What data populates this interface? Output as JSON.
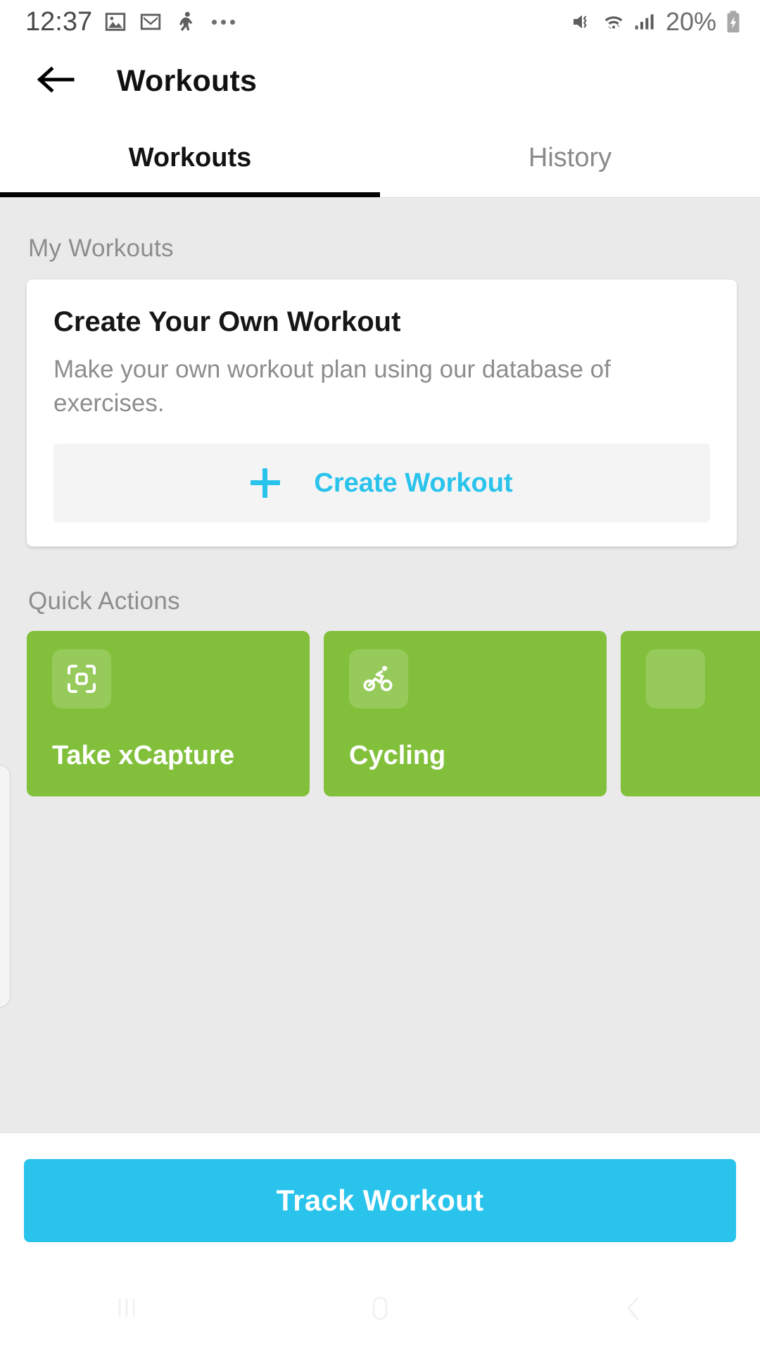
{
  "status_bar": {
    "time": "12:37",
    "battery_percent": "20%",
    "left_icons": [
      "gallery-icon",
      "gmail-icon",
      "fitness-icon",
      "more-dots-icon"
    ],
    "right_icons": [
      "mute-vibrate-icon",
      "wifi-icon",
      "cellular-signal-icon",
      "battery-charging-icon"
    ]
  },
  "app_bar": {
    "back_icon": "back-arrow-icon",
    "title": "Workouts"
  },
  "tabs": [
    {
      "label": "Workouts",
      "active": true
    },
    {
      "label": "History",
      "active": false
    }
  ],
  "sections": {
    "my_workouts_label": "My Workouts",
    "quick_actions_label": "Quick Actions"
  },
  "create_card": {
    "title": "Create Your Own Workout",
    "subtitle": "Make your own workout plan using our database of exercises.",
    "button_label": "Create Workout",
    "button_icon": "plus-icon"
  },
  "quick_actions": [
    {
      "label": "Take xCapture",
      "icon": "scan-frame-icon"
    },
    {
      "label": "Cycling",
      "icon": "cycling-icon"
    },
    {
      "label": "",
      "icon": ""
    }
  ],
  "footer": {
    "track_button_label": "Track Workout"
  },
  "nav_bar": {
    "recents_icon": "recents-icon",
    "home_icon": "home-icon",
    "back_icon": "nav-back-icon"
  },
  "colors": {
    "accent_cyan": "#29c3ec",
    "accent_green": "#82c03c",
    "background_gray": "#eaeaea",
    "text_primary": "#161616",
    "text_secondary": "#8d8d8d"
  }
}
